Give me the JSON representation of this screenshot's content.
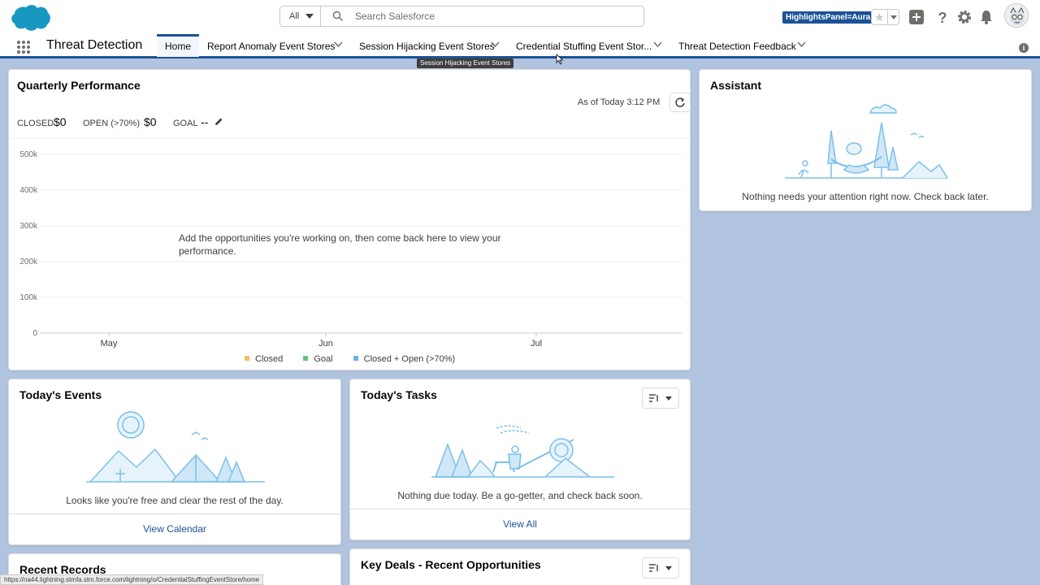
{
  "header": {
    "search": {
      "scope": "All",
      "placeholder": "Search Salesforce"
    },
    "badge": "HighlightsPanel=Aura",
    "icons": [
      "salesforce-cloud-logo",
      "search-icon",
      "star-icon",
      "plus-icon",
      "help-icon",
      "gear-icon",
      "bell-icon",
      "avatar"
    ]
  },
  "nav": {
    "app_name": "Threat Detection",
    "tabs": [
      {
        "label": "Home",
        "active": true
      },
      {
        "label": "Report Anomaly Event Stores",
        "active": false
      },
      {
        "label": "Session Hijacking Event Stores",
        "active": false
      },
      {
        "label": "Credential Stuffing Event Stor...",
        "active": false
      },
      {
        "label": "Threat Detection Feedback",
        "active": false
      }
    ],
    "tooltip": "Session Hijacking Event Stores"
  },
  "quarterly_performance": {
    "title": "Quarterly Performance",
    "as_of": "As of Today 3:12 PM",
    "metrics": {
      "closed_label": "CLOSED",
      "closed_value": "$0",
      "open_label": "OPEN (>70%)",
      "open_value": "$0",
      "goal_label": "GOAL",
      "goal_value": "--"
    },
    "empty_message": "Add the opportunities you're working on, then come back here to view your performance."
  },
  "chart_data": {
    "type": "line",
    "x_ticks": [
      "May",
      "Jun",
      "Jul"
    ],
    "y_ticks": [
      "500k",
      "400k",
      "300k",
      "200k",
      "100k",
      "0"
    ],
    "ylim": [
      0,
      500000
    ],
    "series": [
      {
        "name": "Closed",
        "color": "#f4bc6c",
        "values": []
      },
      {
        "name": "Goal",
        "color": "#6ac186",
        "values": []
      },
      {
        "name": "Closed + Open (>70%)",
        "color": "#6fb5e0",
        "values": []
      }
    ],
    "grid": true,
    "legend": "bottom"
  },
  "assistant": {
    "title": "Assistant",
    "message": "Nothing needs your attention right now. Check back later."
  },
  "todays_events": {
    "title": "Today's Events",
    "message": "Looks like you're free and clear the rest of the day.",
    "link": "View Calendar"
  },
  "todays_tasks": {
    "title": "Today's Tasks",
    "message": "Nothing due today. Be a go-getter, and check back soon.",
    "link": "View All"
  },
  "recent_records": {
    "title": "Recent Records"
  },
  "key_deals": {
    "title": "Key Deals - Recent Opportunities"
  },
  "status_bar": {
    "url": "https://na44.lightning.stmfa.stm.force.com/lightning/o/CredentialStuffingEventStore/home"
  },
  "colors": {
    "brand": "#1b5297",
    "background": "#b0c4df",
    "link": "#1b5297",
    "illustration": "#7bc0e8"
  }
}
